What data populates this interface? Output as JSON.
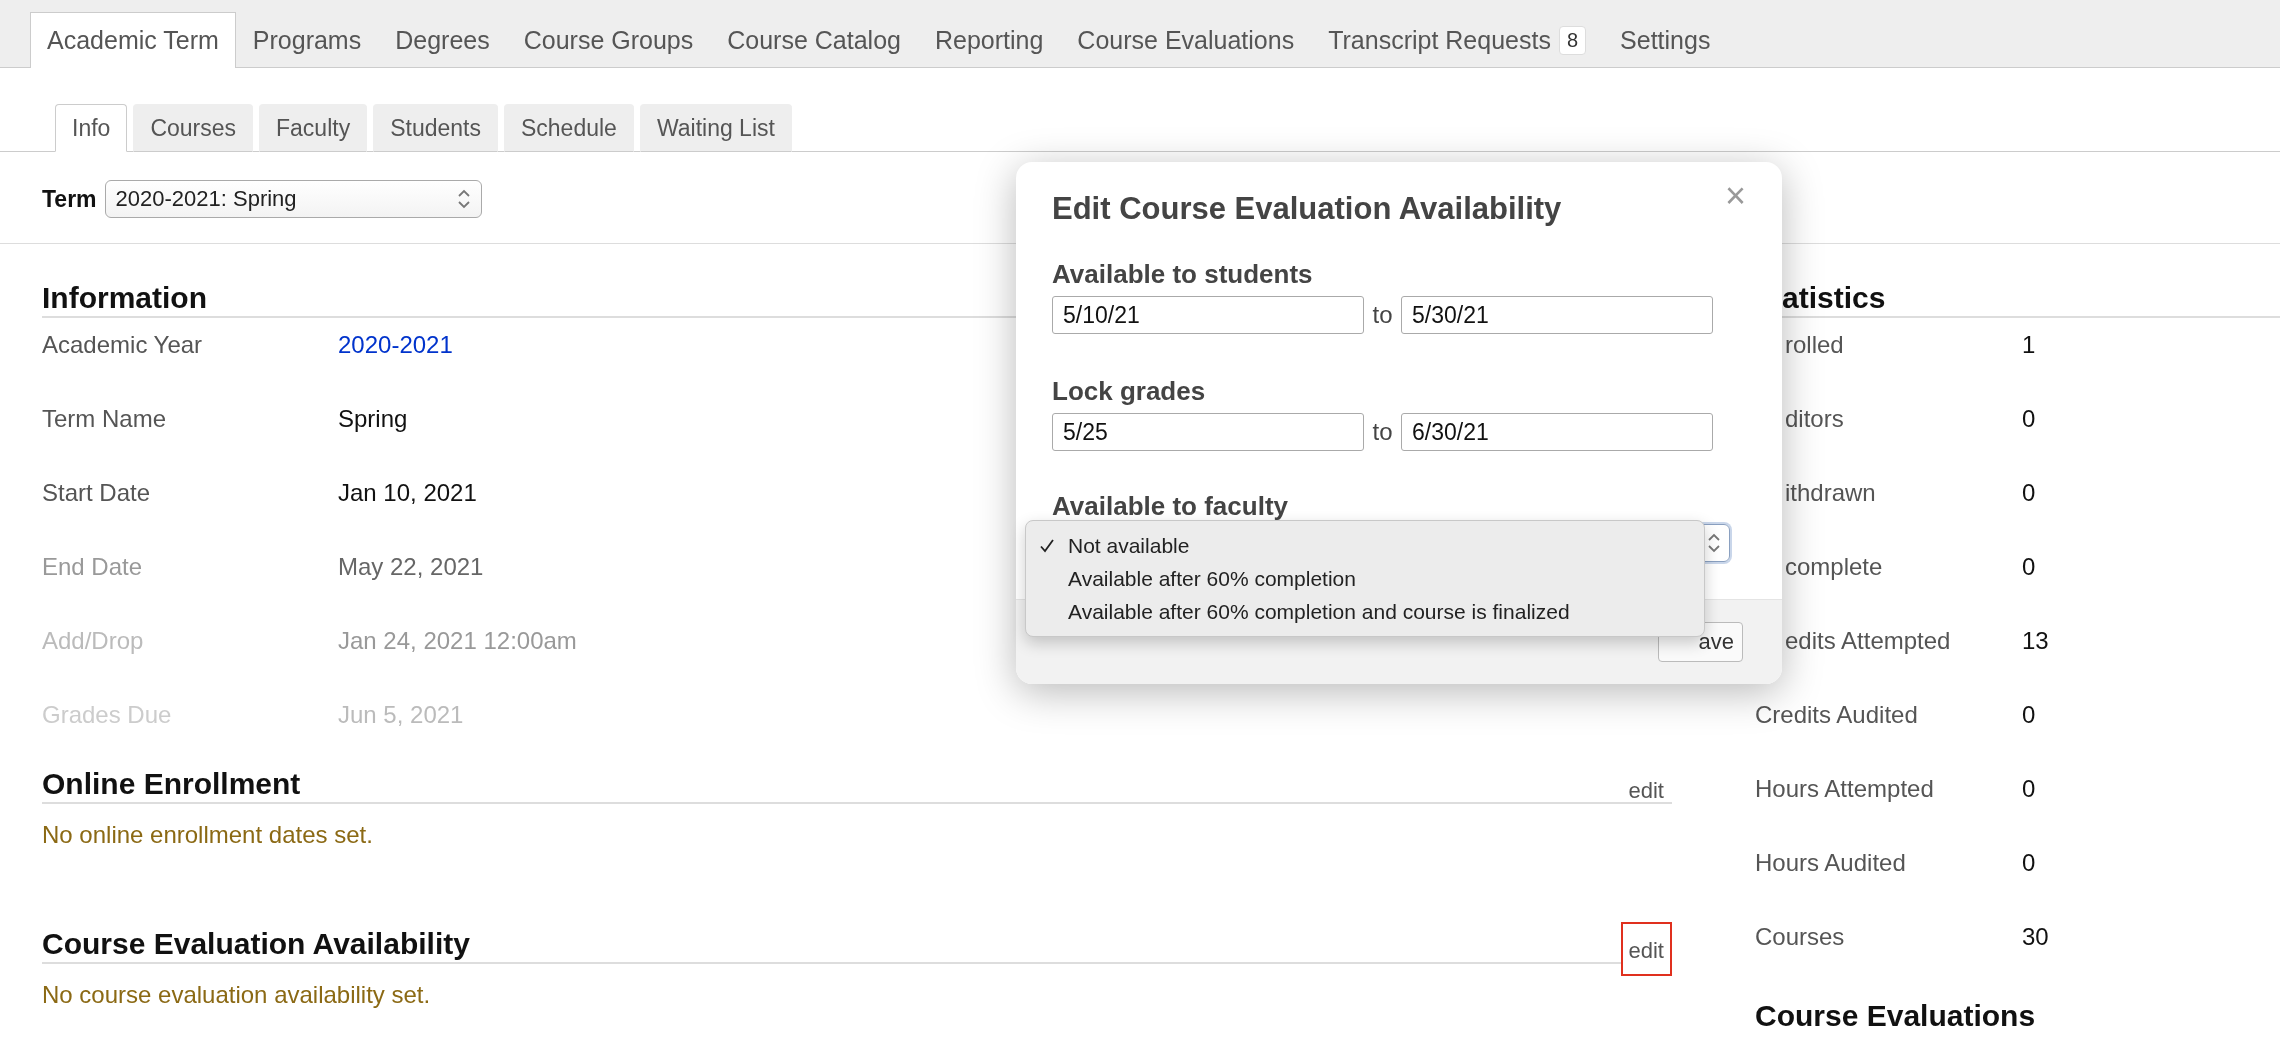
{
  "main_tabs": [
    {
      "label": "Academic Term",
      "selected": true
    },
    {
      "label": "Programs",
      "selected": false
    },
    {
      "label": "Degrees",
      "selected": false
    },
    {
      "label": "Course Groups",
      "selected": false
    },
    {
      "label": "Course Catalog",
      "selected": false
    },
    {
      "label": "Reporting",
      "selected": false
    },
    {
      "label": "Course Evaluations",
      "selected": false
    },
    {
      "label": "Transcript Requests",
      "selected": false,
      "badge": "8"
    },
    {
      "label": "Settings",
      "selected": false
    }
  ],
  "sub_tabs": [
    {
      "label": "Info",
      "selected": true
    },
    {
      "label": "Courses",
      "selected": false
    },
    {
      "label": "Faculty",
      "selected": false
    },
    {
      "label": "Students",
      "selected": false
    },
    {
      "label": "Schedule",
      "selected": false
    },
    {
      "label": "Waiting List",
      "selected": false
    }
  ],
  "term": {
    "label": "Term",
    "value": "2020-2021: Spring"
  },
  "information": {
    "title": "Information",
    "rows": [
      {
        "label": "Academic Year",
        "value": "2020-2021",
        "kind": "normal",
        "link": true
      },
      {
        "label": "Term Name",
        "value": "Spring",
        "kind": "normal",
        "link": false
      },
      {
        "label": "Start Date",
        "value": "Jan 10, 2021",
        "kind": "normal",
        "link": false
      },
      {
        "label": "End Date",
        "value": "May 22, 2021",
        "kind": "muted",
        "link": false
      },
      {
        "label": "Add/Drop",
        "value": "Jan 24, 2021 12:00am",
        "kind": "faint",
        "link": false
      },
      {
        "label": "Grades Due",
        "value": "Jun 5, 2021",
        "kind": "fainter",
        "link": false
      }
    ]
  },
  "sections": [
    {
      "title": "Online Enrollment",
      "action": {
        "label": "edit",
        "highlighted": false
      },
      "message": "No online enrollment dates set."
    },
    {
      "title": "Course Evaluation Availability",
      "action": {
        "label": "edit",
        "highlighted": true
      },
      "message": "No course evaluation availability set."
    }
  ],
  "statistics": {
    "title": {
      "text": "atistics",
      "clipped": true
    },
    "rows": [
      {
        "label": "rolled",
        "value": "1",
        "clipped": true
      },
      {
        "label": "ditors",
        "value": "0",
        "clipped": true
      },
      {
        "label": "ithdrawn",
        "value": "0",
        "clipped": true
      },
      {
        "label": "complete",
        "value": "0",
        "clipped": true
      },
      {
        "label": "edits Attempted",
        "value": "13",
        "clipped": true
      },
      {
        "label": "Credits Audited",
        "value": "0",
        "clipped": false
      },
      {
        "label": "Hours Attempted",
        "value": "0",
        "clipped": false
      },
      {
        "label": "Hours Audited",
        "value": "0",
        "clipped": false
      },
      {
        "label": "Courses",
        "value": "30",
        "clipped": false
      }
    ]
  },
  "course_evaluations": {
    "title": "Course Evaluations"
  },
  "modal": {
    "title": "Edit Course Evaluation Availability",
    "close": "×",
    "groups": [
      {
        "label": "Available to students",
        "from": "5/10/21",
        "separator": "to",
        "to": "5/30/21"
      },
      {
        "label": "Lock grades",
        "from": "5/25",
        "separator": "to",
        "to": "6/30/21"
      }
    ],
    "faculty": {
      "label": "Available to faculty",
      "options": [
        {
          "label": "Not available",
          "selected": true
        },
        {
          "label": "Available after 60% completion",
          "selected": false
        },
        {
          "label": "Available after 60% completion and course is finalized",
          "selected": false
        }
      ]
    },
    "save": "ave"
  }
}
